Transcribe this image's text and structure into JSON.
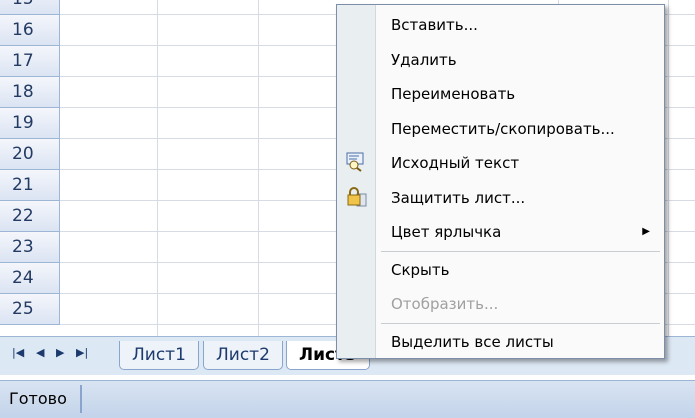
{
  "row_numbers": [
    "15",
    "16",
    "17",
    "18",
    "19",
    "20",
    "21",
    "22",
    "23",
    "24",
    "25"
  ],
  "sheet_tabs": [
    "Лист1",
    "Лист2",
    "Лист3"
  ],
  "nav_buttons": [
    "|◀",
    "◀",
    "▶",
    "▶|"
  ],
  "status": "Готово",
  "menu": {
    "insert": "Вставить...",
    "delete": "Удалить",
    "rename": "Переименовать",
    "move_copy": "Переместить/скопировать...",
    "view_code": "Исходный текст",
    "protect_sheet": "Защитить лист...",
    "tab_color": "Цвет ярлычка",
    "hide": "Скрыть",
    "unhide": "Отобразить...",
    "select_all": "Выделить все листы"
  },
  "colors": {
    "header_bg": "#dbe4f3",
    "tabbar_bg": "#dde8f5",
    "menu_gutter": "#e9eef0",
    "disabled_text": "#a0a0a0"
  }
}
